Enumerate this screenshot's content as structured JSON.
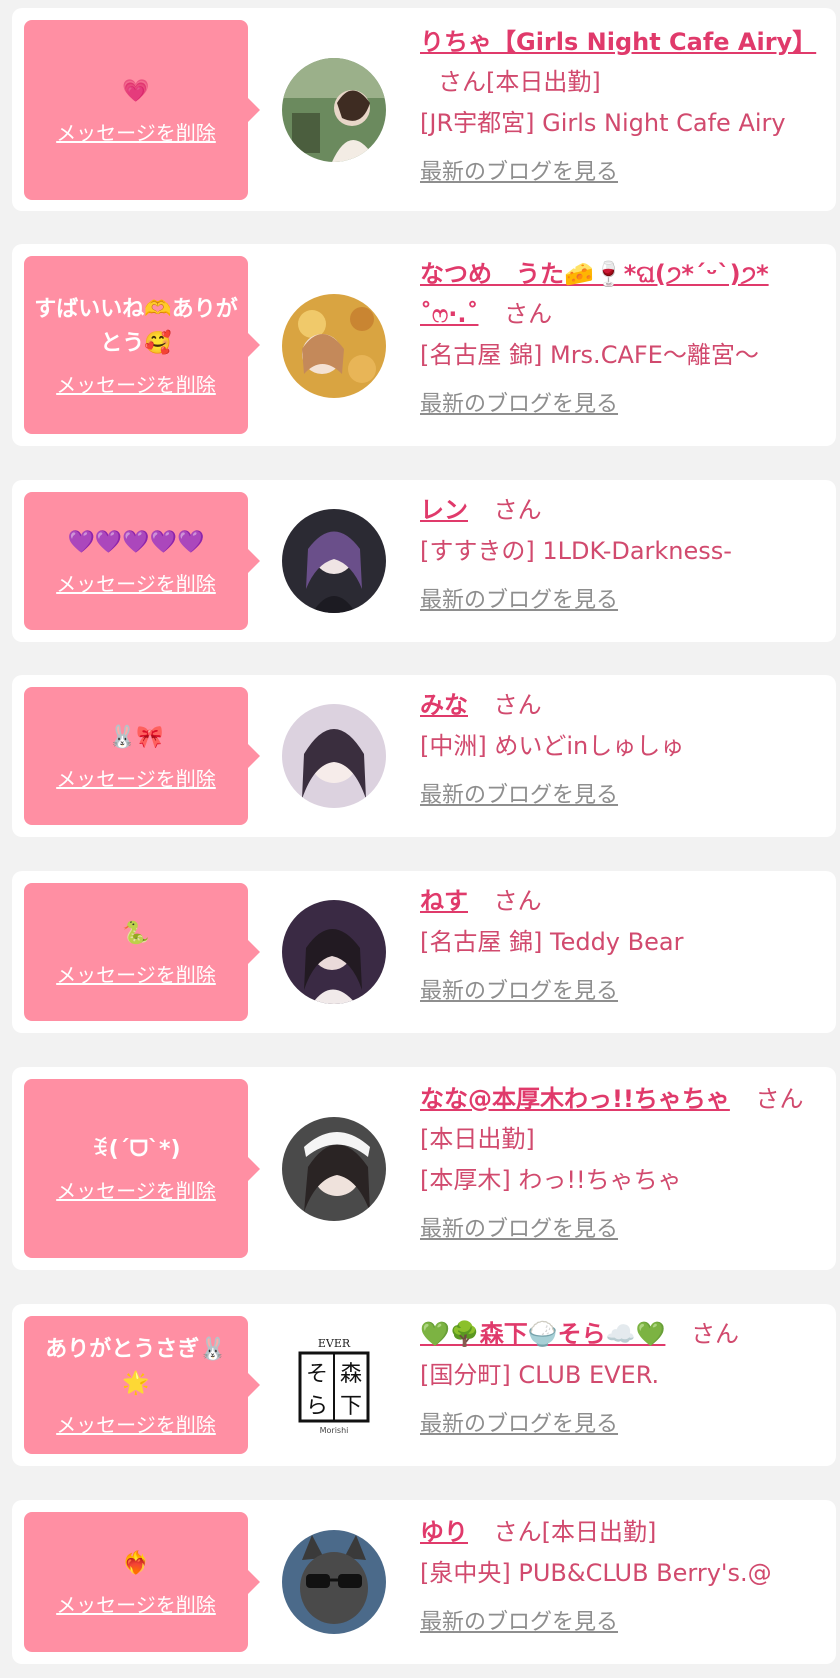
{
  "ui": {
    "delete_label": "メッセージを削除",
    "san_label": "さん",
    "blog_link": "最新のブログを見る"
  },
  "messages": [
    {
      "emoji": "💗",
      "name": "りちゃ【Girls Night Cafe Airy】",
      "status": "[本日出勤]",
      "shop": "[JR宇都宮] Girls Night Cafe Airy"
    },
    {
      "emoji": "すばいいね🫶ありがとう🥰",
      "name": "なつめ　うた🧀🍷*ଘ(੭*ˊᵕˋ)੭*",
      "name2": "˚ෆ·.˚",
      "status": "",
      "shop": "[名古屋 錦] Mrs.CAFE〜離宮〜"
    },
    {
      "emoji": "💜💜💜💜💜",
      "name": "レン",
      "status": "",
      "shop": "[すすきの] 1LDK-Darkness-"
    },
    {
      "emoji": "🐰🎀",
      "name": "みな",
      "status": "",
      "shop": "[中洲] めいどinしゅしゅ"
    },
    {
      "emoji": "🐍",
      "name": "ねす",
      "status": "",
      "shop": "[名古屋 錦] Teddy Bear"
    },
    {
      "emoji": "ꉂ(ˊᗜˋ*)",
      "name": "なな@本厚木わっ!!ちゃちゃ",
      "status": "[本日出勤]",
      "shop": "[本厚木] わっ!!ちゃちゃ"
    },
    {
      "emoji": "ありがとうさぎ🐰🌟",
      "name": "💚🌳森下🍚そら☁️💚",
      "status": "",
      "shop": "[国分町] CLUB EVER."
    },
    {
      "emoji": "❤️‍🔥",
      "name": "ゆり",
      "status": "[本日出勤]",
      "shop": "[泉中央] PUB&CLUB Berry's.@"
    }
  ],
  "avatar_logo": {
    "top": "EVER",
    "kanji": "そら森下",
    "bottom": "Morishi"
  },
  "colors": {
    "bubble": "#ff8fa3",
    "name": "#e03a6b",
    "text": "#d14a6e",
    "blog": "#8e8e8e",
    "background": "#f2f2f2"
  }
}
